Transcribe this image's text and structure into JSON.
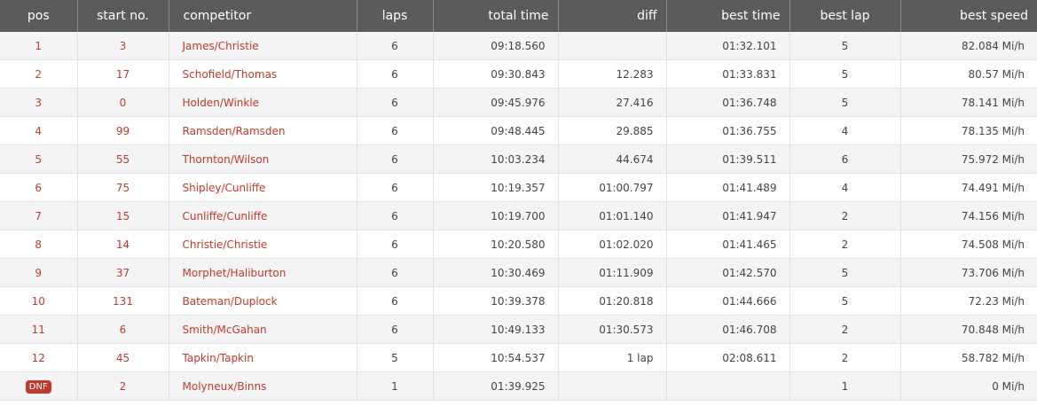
{
  "headers": {
    "pos": "pos",
    "start_no": "start no.",
    "competitor": "competitor",
    "laps": "laps",
    "total_time": "total time",
    "diff": "diff",
    "best_time": "best time",
    "best_lap": "best lap",
    "best_speed": "best speed"
  },
  "rows": [
    {
      "pos": "1",
      "start_no": "3",
      "competitor": "James/Christie",
      "laps": "6",
      "total_time": "09:18.560",
      "diff": "",
      "best_time": "01:32.101",
      "best_lap": "5",
      "best_speed": "82.084 Mi/h"
    },
    {
      "pos": "2",
      "start_no": "17",
      "competitor": "Schofield/Thomas",
      "laps": "6",
      "total_time": "09:30.843",
      "diff": "12.283",
      "best_time": "01:33.831",
      "best_lap": "5",
      "best_speed": "80.57 Mi/h"
    },
    {
      "pos": "3",
      "start_no": "0",
      "competitor": "Holden/Winkle",
      "laps": "6",
      "total_time": "09:45.976",
      "diff": "27.416",
      "best_time": "01:36.748",
      "best_lap": "5",
      "best_speed": "78.141 Mi/h"
    },
    {
      "pos": "4",
      "start_no": "99",
      "competitor": "Ramsden/Ramsden",
      "laps": "6",
      "total_time": "09:48.445",
      "diff": "29.885",
      "best_time": "01:36.755",
      "best_lap": "4",
      "best_speed": "78.135 Mi/h"
    },
    {
      "pos": "5",
      "start_no": "55",
      "competitor": "Thornton/Wilson",
      "laps": "6",
      "total_time": "10:03.234",
      "diff": "44.674",
      "best_time": "01:39.511",
      "best_lap": "6",
      "best_speed": "75.972 Mi/h"
    },
    {
      "pos": "6",
      "start_no": "75",
      "competitor": "Shipley/Cunliffe",
      "laps": "6",
      "total_time": "10:19.357",
      "diff": "01:00.797",
      "best_time": "01:41.489",
      "best_lap": "4",
      "best_speed": "74.491 Mi/h"
    },
    {
      "pos": "7",
      "start_no": "15",
      "competitor": "Cunliffe/Cunliffe",
      "laps": "6",
      "total_time": "10:19.700",
      "diff": "01:01.140",
      "best_time": "01:41.947",
      "best_lap": "2",
      "best_speed": "74.156 Mi/h"
    },
    {
      "pos": "8",
      "start_no": "14",
      "competitor": "Christie/Christie",
      "laps": "6",
      "total_time": "10:20.580",
      "diff": "01:02.020",
      "best_time": "01:41.465",
      "best_lap": "2",
      "best_speed": "74.508 Mi/h"
    },
    {
      "pos": "9",
      "start_no": "37",
      "competitor": "Morphet/Haliburton",
      "laps": "6",
      "total_time": "10:30.469",
      "diff": "01:11.909",
      "best_time": "01:42.570",
      "best_lap": "5",
      "best_speed": "73.706 Mi/h"
    },
    {
      "pos": "10",
      "start_no": "131",
      "competitor": "Bateman/Duplock",
      "laps": "6",
      "total_time": "10:39.378",
      "diff": "01:20.818",
      "best_time": "01:44.666",
      "best_lap": "5",
      "best_speed": "72.23 Mi/h"
    },
    {
      "pos": "11",
      "start_no": "6",
      "competitor": "Smith/McGahan",
      "laps": "6",
      "total_time": "10:49.133",
      "diff": "01:30.573",
      "best_time": "01:46.708",
      "best_lap": "2",
      "best_speed": "70.848 Mi/h"
    },
    {
      "pos": "12",
      "start_no": "45",
      "competitor": "Tapkin/Tapkin",
      "laps": "5",
      "total_time": "10:54.537",
      "diff": "1 lap",
      "best_time": "02:08.611",
      "best_lap": "2",
      "best_speed": "58.782 Mi/h"
    },
    {
      "pos": "DNF",
      "start_no": "2",
      "competitor": "Molyneux/Binns",
      "laps": "1",
      "total_time": "01:39.925",
      "diff": "",
      "best_time": "",
      "best_lap": "1",
      "best_speed": "0 Mi/h"
    }
  ],
  "colors": {
    "header_bg": "#5b5b5b",
    "accent_red": "#c0392b",
    "row_alt": "#f4f4f6"
  }
}
